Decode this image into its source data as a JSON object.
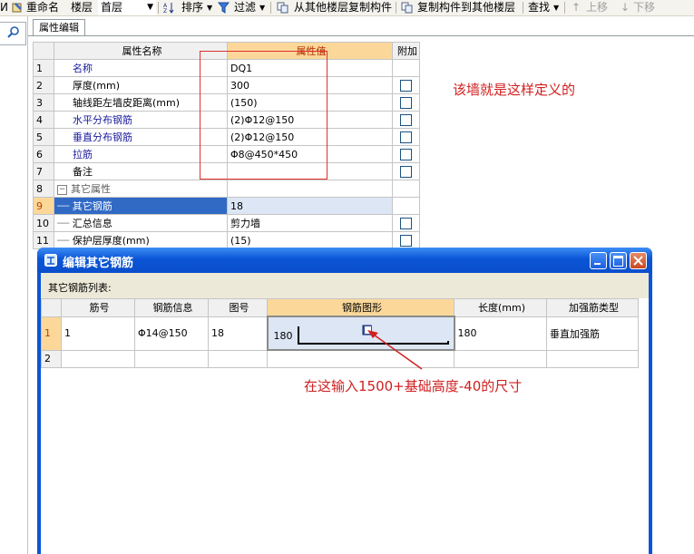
{
  "toolbar": {
    "items": [
      {
        "label": "重命名",
        "icon": "rename-icon"
      },
      {
        "label": "楼层",
        "icon": "none"
      },
      {
        "label": "首层",
        "icon": "combo"
      },
      {
        "label": "排序",
        "icon": "sort-icon"
      },
      {
        "label": "过滤",
        "icon": "filter-icon"
      },
      {
        "label": "从其他楼层复制构件",
        "icon": "copy-from-floor-icon"
      },
      {
        "label": "复制构件到其他楼层",
        "icon": "copy-to-floor-icon"
      },
      {
        "label": "查找",
        "icon": "find"
      },
      {
        "label": "上移",
        "icon": "move-up-icon"
      },
      {
        "label": "下移",
        "icon": "move-down-icon"
      }
    ],
    "left_glyph": "И"
  },
  "tab": {
    "label": "属性编辑"
  },
  "prop_grid": {
    "headers": {
      "name": "属性名称",
      "value": "属性值",
      "extra": "附加"
    },
    "rows": [
      {
        "num": "1",
        "name": "名称",
        "value": "DQ1",
        "checkbox": false
      },
      {
        "num": "2",
        "name": "厚度(mm)",
        "value": "300",
        "checkbox": true
      },
      {
        "num": "3",
        "name": "轴线距左墙皮距离(mm)",
        "value": "(150)",
        "checkbox": true
      },
      {
        "num": "4",
        "name": "水平分布钢筋",
        "value": "(2)Φ12@150",
        "checkbox": true
      },
      {
        "num": "5",
        "name": "垂直分布钢筋",
        "value": "(2)Φ12@150",
        "checkbox": true
      },
      {
        "num": "6",
        "name": "拉筋",
        "value": "Φ8@450*450",
        "checkbox": true
      },
      {
        "num": "7",
        "name": "备注",
        "value": "",
        "checkbox": true
      },
      {
        "num": "8",
        "name": "其它属性",
        "value": "",
        "checkbox": false
      },
      {
        "num": "9",
        "name": "其它钢筋",
        "value": "18",
        "checkbox": false
      },
      {
        "num": "10",
        "name": "汇总信息",
        "value": "剪力墙",
        "checkbox": true
      },
      {
        "num": "11",
        "name": "保护层厚度(mm)",
        "value": "(15)",
        "checkbox": true
      }
    ],
    "selected_row": "9"
  },
  "annotations": {
    "note1": "该墙就是这样定义的",
    "note2": "在这输入1500+基础高度-40的尺寸"
  },
  "dialog": {
    "title": "编辑其它钢筋",
    "list_label": "其它钢筋列表:",
    "headers": [
      "筋号",
      "钢筋信息",
      "图号",
      "钢筋图形",
      "长度(mm)",
      "加强筋类型"
    ],
    "rows": [
      {
        "num": "1",
        "bar_no": "1",
        "info": "Φ14@150",
        "shape_no": "18",
        "shape_left": "180",
        "length": "180",
        "type": "垂直加强筋"
      },
      {
        "num": "2",
        "bar_no": "",
        "info": "",
        "shape_no": "",
        "shape_left": "",
        "length": "",
        "type": ""
      }
    ]
  },
  "colors": {
    "annotation_red": "#d02020",
    "xp_title_blue": "#0a55d6",
    "header_highlight": "#fbd89a",
    "selection_blue": "#316ac5"
  }
}
